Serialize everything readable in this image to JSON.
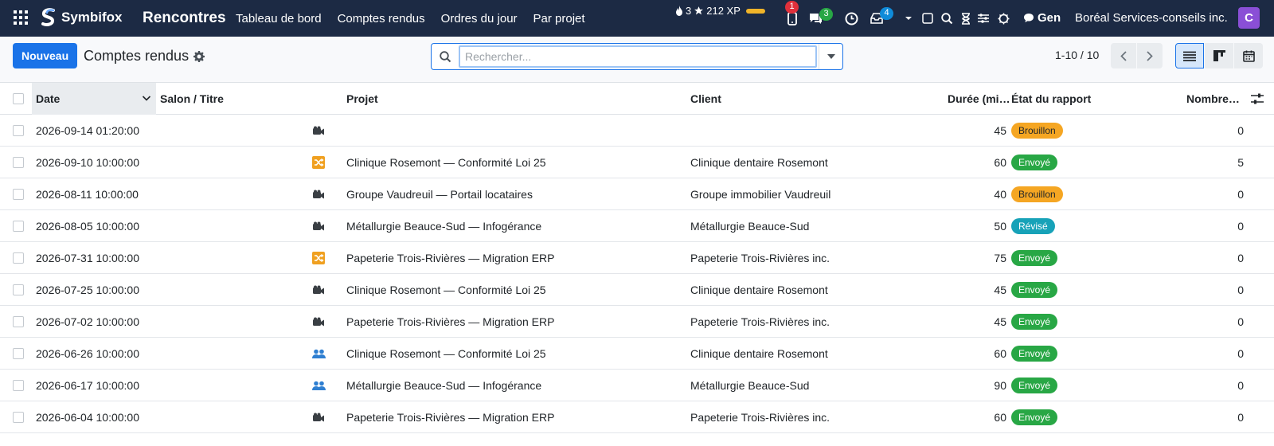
{
  "navbar": {
    "brand": "Symbifox",
    "app_title": "Rencontres",
    "menu": [
      "Tableau de bord",
      "Comptes rendus",
      "Ordres du jour",
      "Par projet"
    ],
    "streak": "3",
    "xp": "212 XP",
    "phone_badge": "1",
    "chat_badge": "3",
    "activity_badge": "4",
    "gen_label": "Gen",
    "company": "Boréal Services-conseils inc.",
    "avatar_letter": "C"
  },
  "control": {
    "new_button": "Nouveau",
    "title": "Comptes rendus",
    "search_placeholder": "Rechercher...",
    "pager": "1-10 / 10"
  },
  "columns": {
    "date": "Date",
    "salon": "Salon / Titre",
    "projet": "Projet",
    "client": "Client",
    "duree": "Durée (minutes)",
    "etat": "État du rapport",
    "nombre": "Nombre de pièces jointes"
  },
  "status_colors": {
    "Brouillon": {
      "bg": "#f5a623",
      "fg": "#212529"
    },
    "Envoyé": {
      "bg": "#28a745",
      "fg": "#ffffff"
    },
    "Révisé": {
      "bg": "#17a2b8",
      "fg": "#ffffff"
    }
  },
  "rows": [
    {
      "date": "2026-09-14 01:20:00",
      "icon": "camera-icon",
      "projet": "",
      "client": "",
      "duree": "45",
      "etat": "Brouillon",
      "nombre": "0"
    },
    {
      "date": "2026-09-10 10:00:00",
      "icon": "shuffle-icon",
      "projet": "Clinique Rosemont — Conformité Loi 25",
      "client": "Clinique dentaire Rosemont",
      "duree": "60",
      "etat": "Envoyé",
      "nombre": "5"
    },
    {
      "date": "2026-08-11 10:00:00",
      "icon": "camera-icon",
      "projet": "Groupe Vaudreuil — Portail locataires",
      "client": "Groupe immobilier Vaudreuil",
      "duree": "40",
      "etat": "Brouillon",
      "nombre": "0"
    },
    {
      "date": "2026-08-05 10:00:00",
      "icon": "camera-icon",
      "projet": "Métallurgie Beauce-Sud — Infogérance",
      "client": "Métallurgie Beauce-Sud",
      "duree": "50",
      "etat": "Révisé",
      "nombre": "0"
    },
    {
      "date": "2026-07-31 10:00:00",
      "icon": "shuffle-icon",
      "projet": "Papeterie Trois-Rivières — Migration ERP",
      "client": "Papeterie Trois-Rivières inc.",
      "duree": "75",
      "etat": "Envoyé",
      "nombre": "0"
    },
    {
      "date": "2026-07-25 10:00:00",
      "icon": "camera-icon",
      "projet": "Clinique Rosemont — Conformité Loi 25",
      "client": "Clinique dentaire Rosemont",
      "duree": "45",
      "etat": "Envoyé",
      "nombre": "0"
    },
    {
      "date": "2026-07-02 10:00:00",
      "icon": "camera-icon",
      "projet": "Papeterie Trois-Rivières — Migration ERP",
      "client": "Papeterie Trois-Rivières inc.",
      "duree": "45",
      "etat": "Envoyé",
      "nombre": "0"
    },
    {
      "date": "2026-06-26 10:00:00",
      "icon": "people-icon",
      "projet": "Clinique Rosemont — Conformité Loi 25",
      "client": "Clinique dentaire Rosemont",
      "duree": "60",
      "etat": "Envoyé",
      "nombre": "0"
    },
    {
      "date": "2026-06-17 10:00:00",
      "icon": "people-icon",
      "projet": "Métallurgie Beauce-Sud — Infogérance",
      "client": "Métallurgie Beauce-Sud",
      "duree": "90",
      "etat": "Envoyé",
      "nombre": "0"
    },
    {
      "date": "2026-06-04 10:00:00",
      "icon": "camera-icon",
      "projet": "Papeterie Trois-Rivières — Migration ERP",
      "client": "Papeterie Trois-Rivières inc.",
      "duree": "60",
      "etat": "Envoyé",
      "nombre": "0"
    }
  ]
}
